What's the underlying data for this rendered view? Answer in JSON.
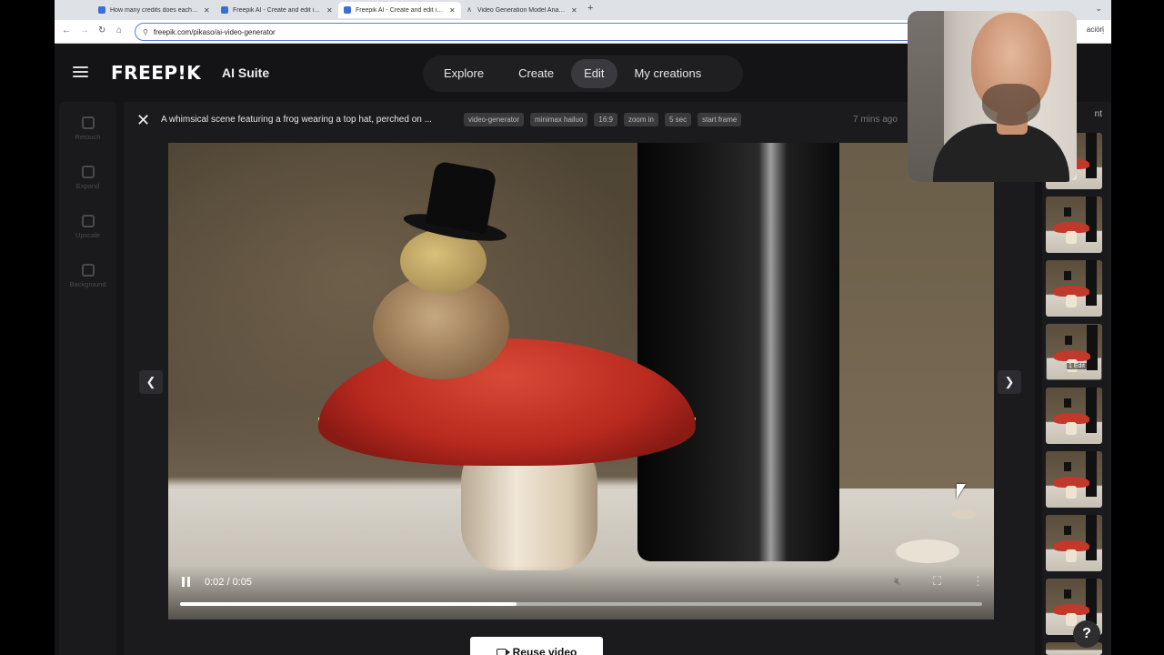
{
  "browser": {
    "tabs": [
      {
        "title": "How many credits does each…",
        "active": false
      },
      {
        "title": "Freepik AI - Create and edit i…",
        "active": false
      },
      {
        "title": "Freepik AI - Create and edit i…",
        "active": true
      },
      {
        "title": "Video Generation Model Ana…",
        "active": false
      }
    ],
    "new_tab": "+",
    "url": "freepik.com/pikaso/ai-video-generator",
    "right_text": "ación"
  },
  "header": {
    "logo": "FREEP!K",
    "suite": "AI Suite",
    "nav": [
      {
        "label": "Explore",
        "active": false
      },
      {
        "label": "Create",
        "active": false
      },
      {
        "label": "Edit",
        "active": true
      },
      {
        "label": "My creations",
        "active": false
      }
    ]
  },
  "left_tools": [
    {
      "label": "Retouch",
      "icon": "bandage-icon"
    },
    {
      "label": "Expand",
      "icon": "expand-icon"
    },
    {
      "label": "Upscale",
      "icon": "upscale-icon"
    },
    {
      "label": "Background",
      "icon": "background-icon"
    }
  ],
  "detail": {
    "close": "✕",
    "prompt": "A whimsical scene featuring a frog wearing a top hat, perched on ...",
    "tags": [
      "video-generator",
      "minimax hailuo",
      "16:9",
      "zoom in",
      "5 sec",
      "start frame"
    ],
    "time_ago": "7 mins ago"
  },
  "video": {
    "time": "0:02 / 0:05",
    "progress": 0.42,
    "reuse_label": "Reuse video",
    "mute_icon": "mute-icon",
    "fullscreen_icon": "fullscreen-icon",
    "more_icon": "more-icon"
  },
  "history": {
    "label": "nt",
    "badge": "1 Edit",
    "thumb_count": 9
  },
  "help": "?",
  "colors": {
    "app_bg": "#141416",
    "accent": "#3b6fd8"
  }
}
